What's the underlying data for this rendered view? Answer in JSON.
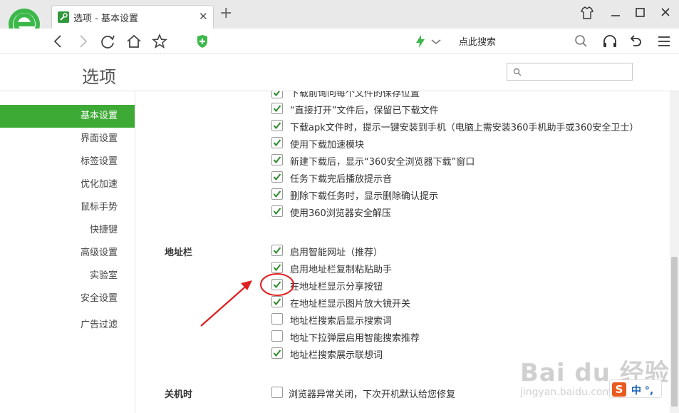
{
  "browser": {
    "tab_title": "选项 - 基本设置",
    "search_placeholder": "点此搜索"
  },
  "page": {
    "title": "选项"
  },
  "sidebar": {
    "items": [
      {
        "label": "基本设置",
        "active": true
      },
      {
        "label": "界面设置"
      },
      {
        "label": "标签设置"
      },
      {
        "label": "优化加速"
      },
      {
        "label": "鼠标手势"
      },
      {
        "label": "快捷键"
      },
      {
        "label": "高级设置"
      },
      {
        "label": "实验室"
      },
      {
        "label": "安全设置"
      },
      {
        "label": "广告过滤"
      }
    ]
  },
  "download_options": [
    {
      "label": "下载前询问每个文件的保存位置",
      "checked": true
    },
    {
      "label": "“直接打开”文件后，保留已下载文件",
      "checked": true
    },
    {
      "label": "下载apk文件时，提示一键安装到手机（电脑上需安装360手机助手或360安全卫士）",
      "checked": true
    },
    {
      "label": "使用下载加速模块",
      "checked": true
    },
    {
      "label": "新建下载后，显示“360安全浏览器下载”窗口",
      "checked": true
    },
    {
      "label": "任务下载完后播放提示音",
      "checked": true
    },
    {
      "label": "删除下载任务时，显示删除确认提示",
      "checked": true
    },
    {
      "label": "使用360浏览器安全解压",
      "checked": true
    }
  ],
  "address_bar": {
    "section_label": "地址栏",
    "options": [
      {
        "label": "启用智能网址（推荐）",
        "checked": true
      },
      {
        "label": "启用地址栏复制粘贴助手",
        "checked": true
      },
      {
        "label": "在地址栏显示分享按钮",
        "checked": true,
        "highlighted": true
      },
      {
        "label": "在地址栏显示图片放大镜开关",
        "checked": true
      },
      {
        "label": "地址栏搜索后显示搜索词",
        "checked": false
      },
      {
        "label": "地址下拉弹层启用智能搜索推荐",
        "checked": false
      },
      {
        "label": "地址栏搜索展示联想词",
        "checked": true
      }
    ]
  },
  "shutdown": {
    "section_label": "关机时",
    "options": [
      {
        "label": "浏览器异常关闭，下次开机默认给您修复",
        "checked": false
      }
    ]
  },
  "watermark": {
    "main": "Bai du 经验",
    "sub": "jingyan.baidu.com"
  },
  "ime": {
    "logo": "S",
    "text": "中 °,"
  },
  "colors": {
    "accent": "#3daa35",
    "check": "#2e8b2e",
    "annotation": "#e0201f"
  }
}
